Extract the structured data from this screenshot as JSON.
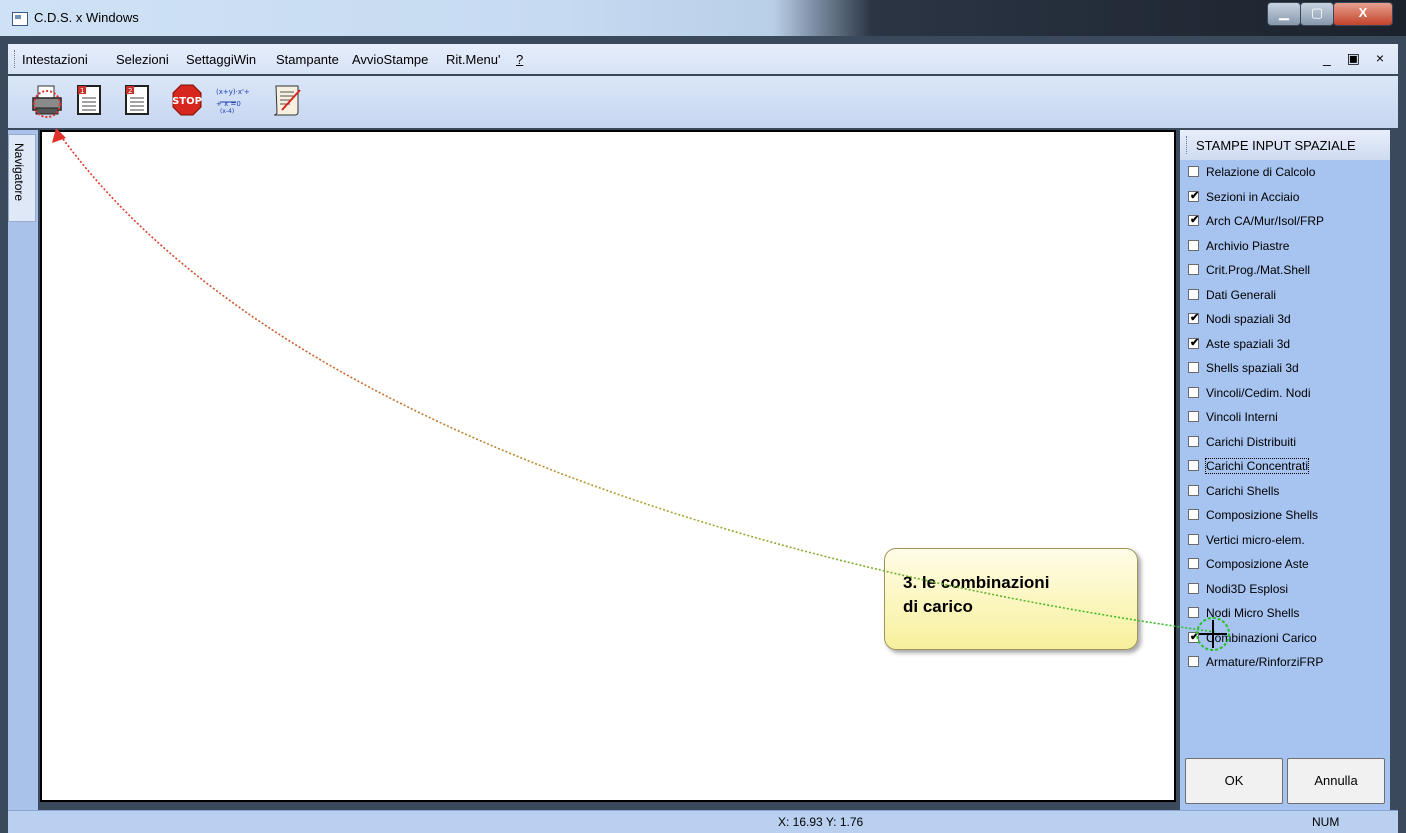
{
  "window": {
    "title": "C.D.S. x Windows",
    "controls": {
      "minimize": "▁",
      "maximize": "▢",
      "close": "X"
    }
  },
  "menu": {
    "items": [
      "Intestazioni",
      "Selezioni",
      "SettaggiWin",
      "Stampante",
      "AvvioStampe",
      "Rit.Menu'",
      "?"
    ],
    "mdi_controls": "_ ▣ ×"
  },
  "toolbar": {
    "icons": [
      "printer-icon",
      "document-1-icon",
      "document-2-icon",
      "stop-icon",
      "formula-icon",
      "scroll-edit-icon"
    ],
    "stop_label": "STOP"
  },
  "navigator": {
    "label": "Navigatore"
  },
  "panel": {
    "title": "STAMPE INPUT SPAZIALE",
    "items": [
      {
        "label": "Relazione di Calcolo",
        "checked": false
      },
      {
        "label": "Sezioni in Acciaio",
        "checked": true
      },
      {
        "label": "Arch CA/Mur/Isol/FRP",
        "checked": true
      },
      {
        "label": "Archivio Piastre",
        "checked": false
      },
      {
        "label": "Crit.Prog./Mat.Shell",
        "checked": false
      },
      {
        "label": "Dati Generali",
        "checked": false
      },
      {
        "label": "Nodi spaziali 3d",
        "checked": true
      },
      {
        "label": "Aste spaziali 3d",
        "checked": true
      },
      {
        "label": "Shells spaziali 3d",
        "checked": false
      },
      {
        "label": "Vincoli/Cedim. Nodi",
        "checked": false
      },
      {
        "label": "Vincoli Interni",
        "checked": false
      },
      {
        "label": "Carichi Distribuiti",
        "checked": false
      },
      {
        "label": "Carichi Concentrati",
        "checked": false,
        "focused": true
      },
      {
        "label": "Carichi Shells",
        "checked": false
      },
      {
        "label": "Composizione Shells",
        "checked": false
      },
      {
        "label": "Vertici micro-elem.",
        "checked": false
      },
      {
        "label": "Composizione Aste",
        "checked": false
      },
      {
        "label": "Nodi3D Esplosi",
        "checked": false
      },
      {
        "label": "Nodi Micro Shells",
        "checked": false
      },
      {
        "label": "Combinazioni Carico",
        "checked": true
      },
      {
        "label": "Armature/RinforziFRP",
        "checked": false
      }
    ],
    "ok_label": "OK",
    "cancel_label": "Annulla"
  },
  "status": {
    "coords": "X: 16.93  Y: 1.76",
    "num": "NUM"
  },
  "callout": {
    "text": "3. le combinazioni\ndi carico"
  },
  "colors": {
    "accent": "#a7c3ef",
    "arrow_red": "#e0322a",
    "arrow_green": "#2bc02b"
  }
}
